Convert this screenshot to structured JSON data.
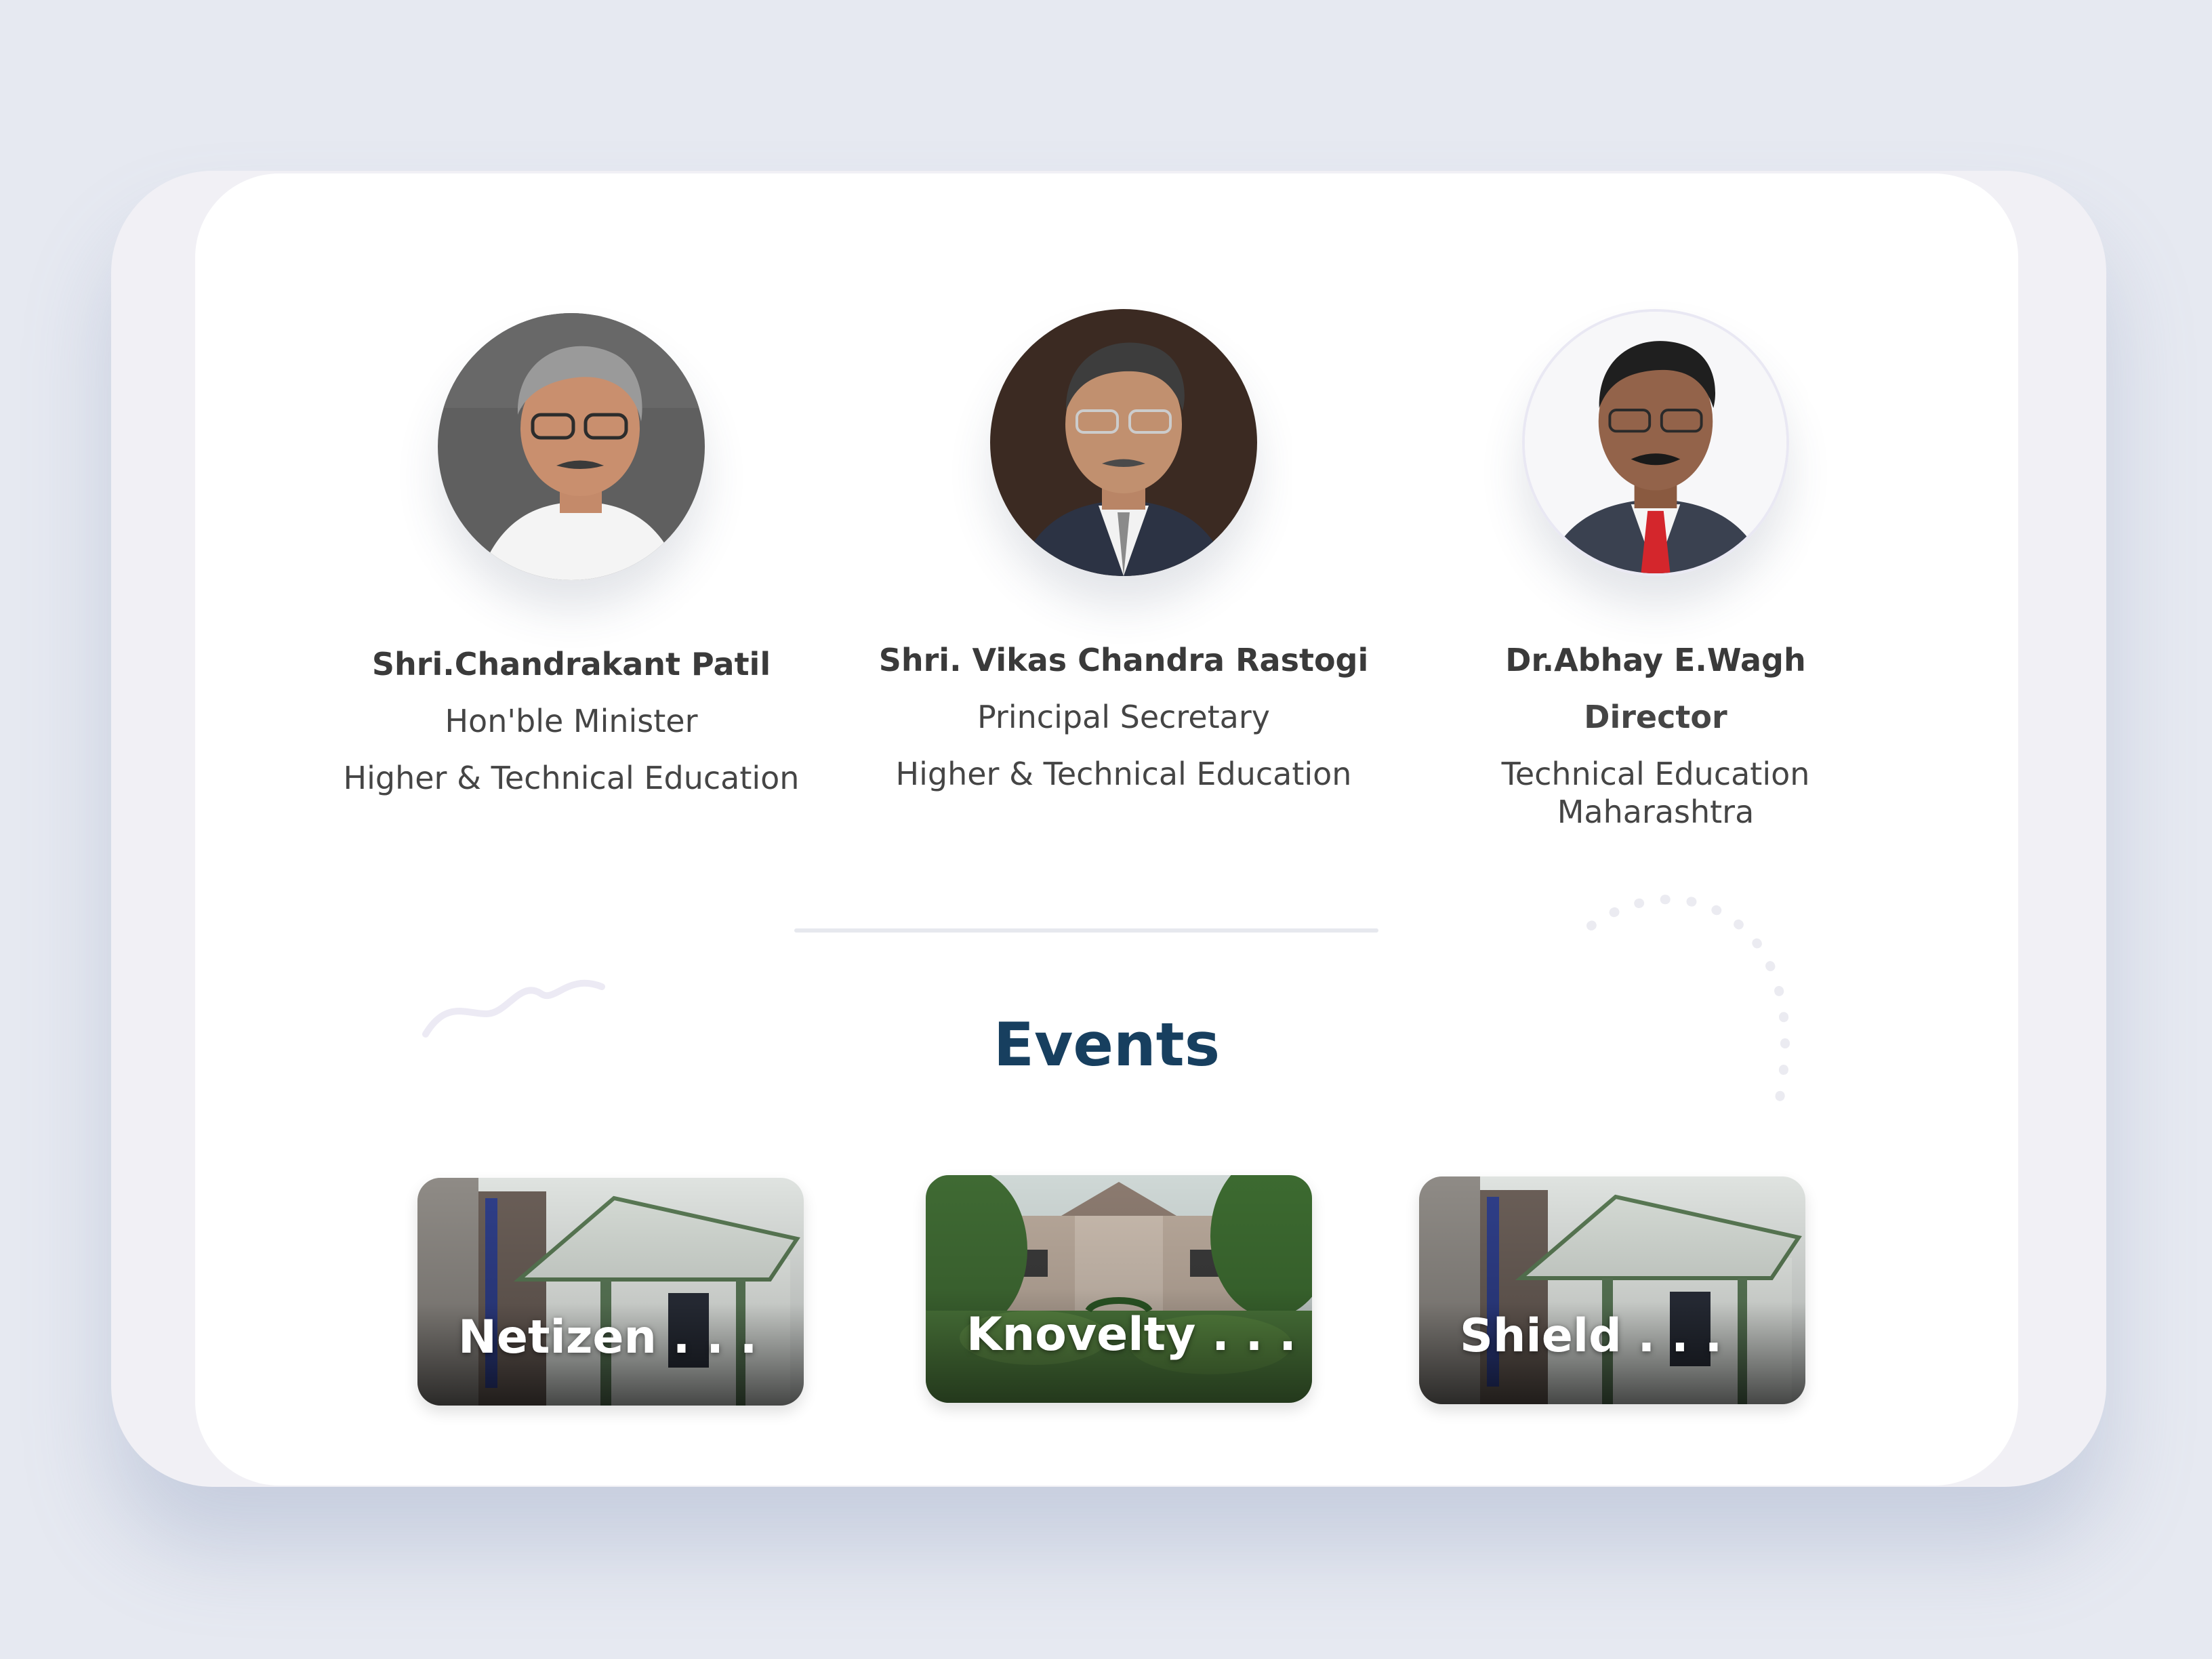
{
  "people": [
    {
      "name": "Shri.Chandrakant Patil",
      "role": "Hon'ble Minister",
      "department": "Higher & Technical Education"
    },
    {
      "name": "Shri. Vikas Chandra Rastogi",
      "role": "Principal Secretary",
      "department": "Higher & Technical Education"
    },
    {
      "name": "Dr.Abhay E.Wagh",
      "role": "Director",
      "department": "Technical Education Maharashtra"
    }
  ],
  "events": {
    "title": "Events",
    "cards": [
      {
        "label": "Netizen . . ."
      },
      {
        "label": "Knovelty . . ."
      },
      {
        "label": "Shield . . ."
      }
    ]
  },
  "colors": {
    "background": "#e6e9f1",
    "device_frame": "#f1f0f5",
    "screen": "#ffffff",
    "heading": "#173f5f",
    "text": "#454545"
  }
}
